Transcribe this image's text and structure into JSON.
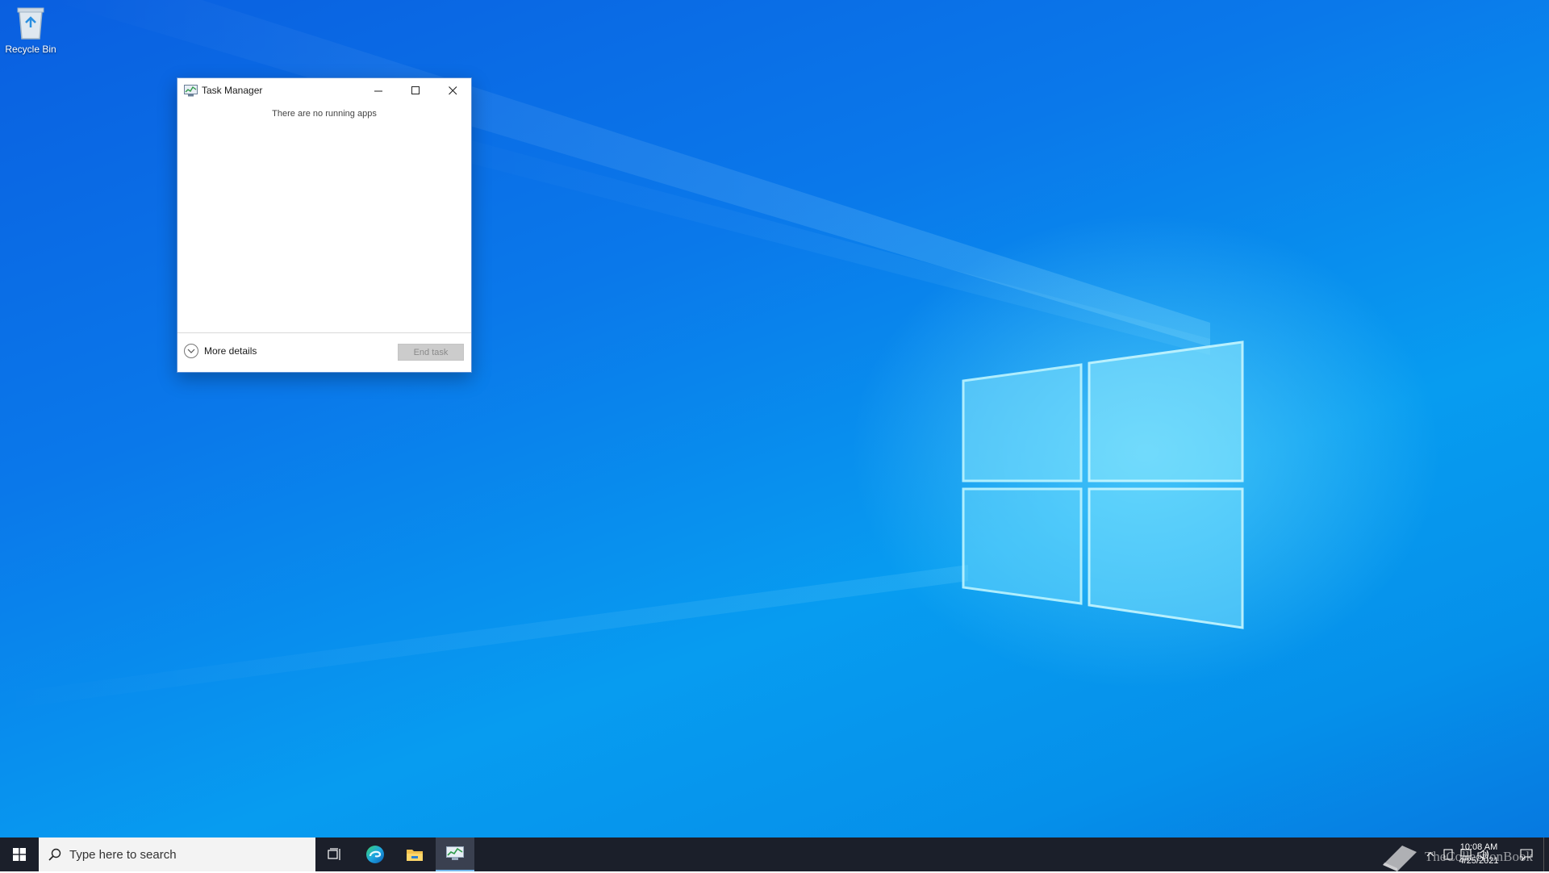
{
  "desktop": {
    "icons": [
      {
        "label": "Recycle Bin",
        "icon": "recycle-bin-icon"
      }
    ]
  },
  "task_manager": {
    "title": "Task Manager",
    "empty_message": "There are no running apps",
    "more_details_label": "More details",
    "end_task_label": "End task",
    "controls": [
      "minimize-icon",
      "maximize-icon",
      "close-icon"
    ]
  },
  "taskbar": {
    "search_placeholder": "Type here to search",
    "pinned": [
      "start-icon",
      "task-view-icon",
      "edge-icon",
      "file-explorer-icon",
      "task-manager-icon"
    ],
    "clock": {
      "time": "10:08 AM",
      "date": "4/25/2021"
    },
    "tray_icons": [
      "chevron-up-icon",
      "tablet-icon",
      "network-icon",
      "volume-icon",
      "notifications-icon"
    ]
  },
  "watermark": {
    "text": "TheCollectionBook"
  },
  "colors": {
    "accent": "#0078d7",
    "taskbar": "#1b1f2a",
    "end_task_disabled": "#cccccc"
  }
}
